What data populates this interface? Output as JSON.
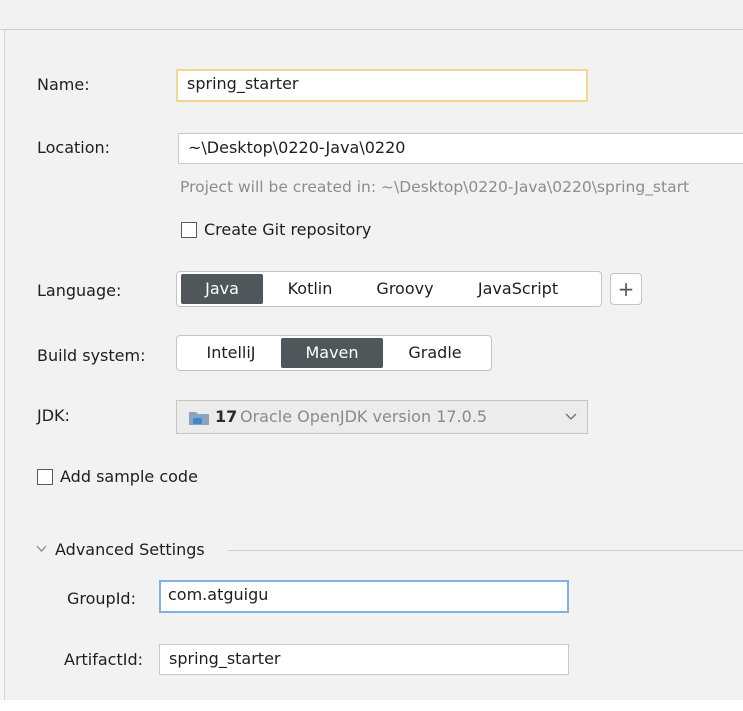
{
  "form": {
    "name_label": "Name:",
    "name_value": "spring_starter",
    "location_label": "Location:",
    "location_value": "~\\Desktop\\0220-Java\\0220",
    "location_hint": "Project will be created in: ~\\Desktop\\0220-Java\\0220\\spring_start",
    "git_label": "Create Git repository",
    "git_checked": false,
    "language_label": "Language:",
    "languages": [
      "Java",
      "Kotlin",
      "Groovy",
      "JavaScript"
    ],
    "language_selected": "Java",
    "add_language_icon": "plus-icon",
    "build_label": "Build system:",
    "build_systems": [
      "IntelliJ",
      "Maven",
      "Gradle"
    ],
    "build_selected": "Maven",
    "jdk_label": "JDK:",
    "jdk_version": "17",
    "jdk_desc": "Oracle OpenJDK version 17.0.5",
    "sample_code_label": "Add sample code",
    "sample_code_checked": false
  },
  "advanced": {
    "title": "Advanced Settings",
    "groupid_label": "GroupId:",
    "groupid_value": "com.atguigu",
    "artifactid_label": "ArtifactId:",
    "artifactid_value": "spring_starter"
  },
  "colors": {
    "active_segment": "#50575b",
    "focus_orange": "#f2d792",
    "focus_blue": "#7fb1e6",
    "hint": "#8c8c8c"
  }
}
